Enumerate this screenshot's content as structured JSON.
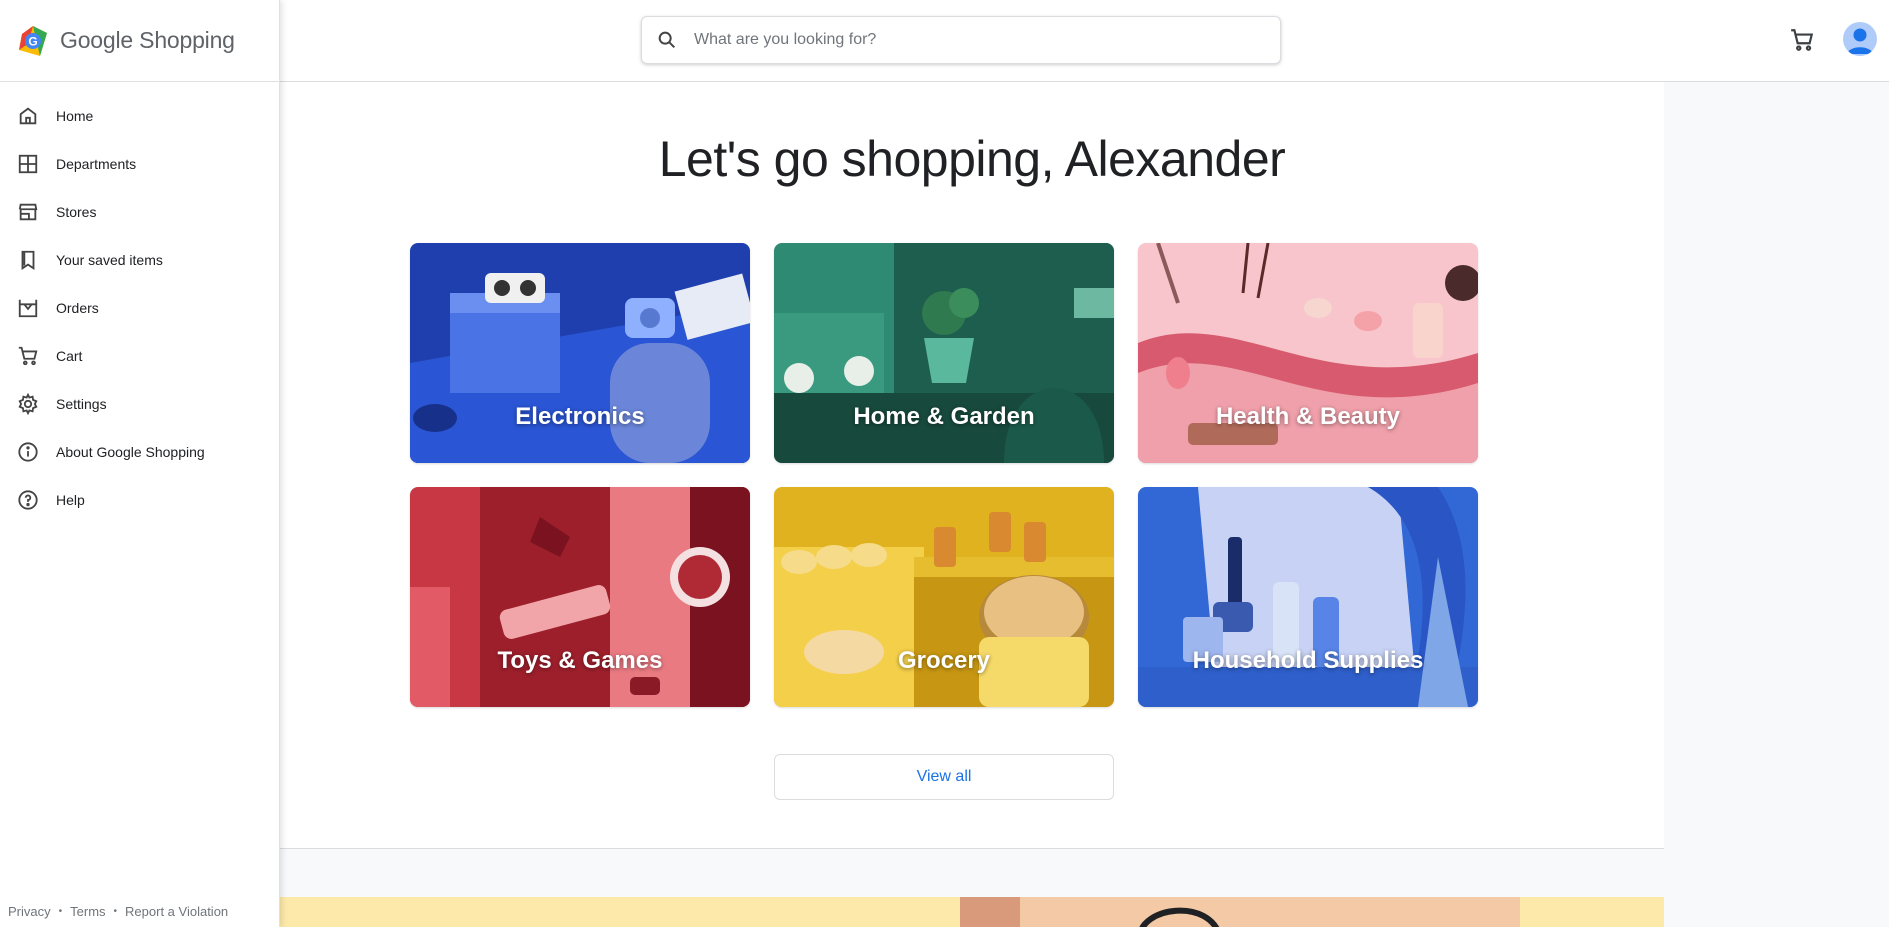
{
  "brand": {
    "google": "Google",
    "shopping": "Shopping"
  },
  "search": {
    "placeholder": "What are you looking for?"
  },
  "sidebar": {
    "items": [
      {
        "label": "Home",
        "icon": "home-icon"
      },
      {
        "label": "Departments",
        "icon": "grid-icon"
      },
      {
        "label": "Stores",
        "icon": "store-icon"
      },
      {
        "label": "Your saved items",
        "icon": "bookmark-icon"
      },
      {
        "label": "Orders",
        "icon": "orders-icon"
      },
      {
        "label": "Cart",
        "icon": "cart-icon"
      },
      {
        "label": "Settings",
        "icon": "gear-icon"
      },
      {
        "label": "About Google Shopping",
        "icon": "info-icon"
      },
      {
        "label": "Help",
        "icon": "help-icon"
      }
    ],
    "footer": {
      "privacy": "Privacy",
      "terms": "Terms",
      "report": "Report a Violation"
    }
  },
  "main": {
    "greeting": "Let's go shopping, Alexander",
    "categories": [
      {
        "label": "Electronics",
        "color": "#2d4fc9"
      },
      {
        "label": "Home & Garden",
        "color": "#2b7a67"
      },
      {
        "label": "Health & Beauty",
        "color": "#f2a7b0"
      },
      {
        "label": "Toys & Games",
        "color": "#b8323f"
      },
      {
        "label": "Grocery",
        "color": "#d9a91b"
      },
      {
        "label": "Household Supplies",
        "color": "#3a6fd8"
      }
    ],
    "view_all": "View all"
  },
  "colors": {
    "accent": "#1a73e8",
    "text": "#202124",
    "muted": "#70757a"
  }
}
